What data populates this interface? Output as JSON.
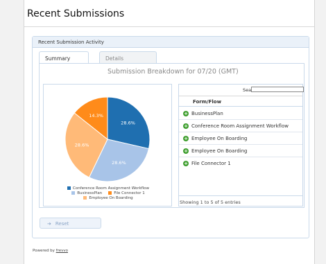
{
  "page": {
    "title": "Recent Submissions",
    "panel_title": "Recent Submission Activity"
  },
  "tabs": [
    {
      "label": "Summary",
      "active": true
    },
    {
      "label": "Details",
      "active": false
    }
  ],
  "summary": {
    "heading": "Submission Breakdown for 07/20 (GMT)"
  },
  "chart_data": {
    "type": "pie",
    "slices": [
      {
        "label": "Conference Room Assignment Workflow",
        "value": 28.6,
        "display": "28.6%",
        "color": "#1f6fb0"
      },
      {
        "label": "BusinessPlan",
        "value": 28.6,
        "display": "28.6%",
        "color": "#a8c4e8"
      },
      {
        "label": "Employee On Boarding",
        "value": 28.6,
        "display": "28.6%",
        "color": "#ffba78"
      },
      {
        "label": "File Connector 1",
        "value": 14.3,
        "display": "14.3%",
        "color": "#ff8b1a"
      }
    ],
    "legend_position": "bottom"
  },
  "table": {
    "search_label": "Search:",
    "search_value": "",
    "column_header": "Form/Flow",
    "rows": [
      "BusinessPlan",
      "Conference Room Assignment Workflow",
      "Employee On Boarding",
      "Employee On Boarding",
      "File Connector 1"
    ],
    "footer": "Showing 1 to 5 of 5 entries"
  },
  "reset": {
    "label": "Reset",
    "icon": "arrow-icon"
  },
  "footer": {
    "powered_by": "Powered by",
    "link": "frevvo"
  }
}
